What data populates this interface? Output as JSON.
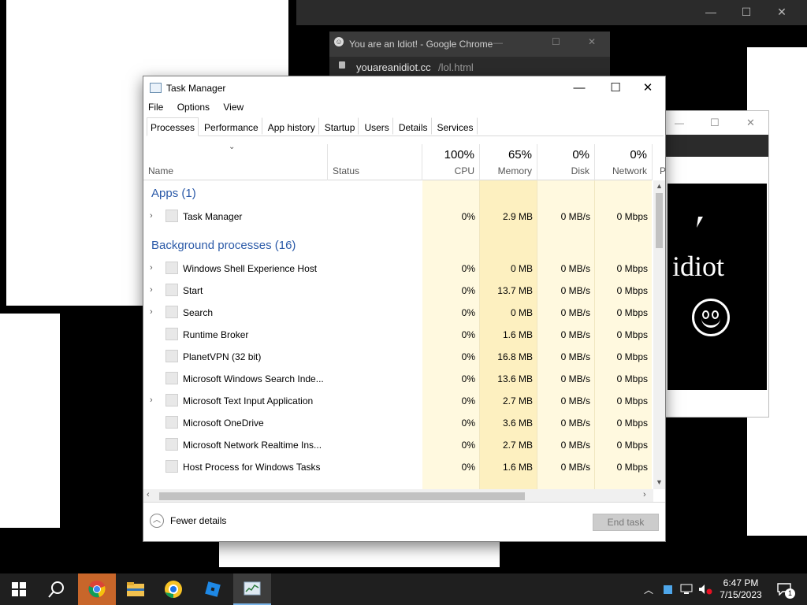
{
  "background_windows": {
    "back_controls": [
      "—",
      "☐",
      "✕"
    ],
    "right_popup_controls": [
      "—",
      "☐",
      "✕"
    ],
    "popup_text": "idiot"
  },
  "chrome_popup": {
    "title": "You are an Idiot! - Google Chrome",
    "url_host": "youareanidiot.cc",
    "url_path": "/lol.html",
    "controls": [
      "—",
      "☐",
      "✕"
    ]
  },
  "task_manager": {
    "title": "Task Manager",
    "controls": [
      "—",
      "☐",
      "✕"
    ],
    "menu": [
      "File",
      "Options",
      "View"
    ],
    "tabs": [
      "Processes",
      "Performance",
      "App history",
      "Startup",
      "Users",
      "Details",
      "Services"
    ],
    "active_tab": "Processes",
    "columns": {
      "name": "Name",
      "status": "Status",
      "cpu": {
        "percent": "100%",
        "label": "CPU"
      },
      "memory": {
        "percent": "65%",
        "label": "Memory"
      },
      "disk": {
        "percent": "0%",
        "label": "Disk"
      },
      "network": {
        "percent": "0%",
        "label": "Network"
      },
      "power_truncated": "P"
    },
    "groups": {
      "apps": "Apps (1)",
      "background": "Background processes (16)"
    },
    "app_rows": [
      {
        "name": "Task Manager",
        "expandable": true,
        "cpu": "0%",
        "memory": "2.9 MB",
        "disk": "0 MB/s",
        "network": "0 Mbps"
      }
    ],
    "bg_rows": [
      {
        "name": "Windows Shell Experience Host",
        "expandable": true,
        "cpu": "0%",
        "memory": "0 MB",
        "disk": "0 MB/s",
        "network": "0 Mbps"
      },
      {
        "name": "Start",
        "expandable": true,
        "cpu": "0%",
        "memory": "13.7 MB",
        "disk": "0 MB/s",
        "network": "0 Mbps"
      },
      {
        "name": "Search",
        "expandable": true,
        "cpu": "0%",
        "memory": "0 MB",
        "disk": "0 MB/s",
        "network": "0 Mbps"
      },
      {
        "name": "Runtime Broker",
        "expandable": false,
        "cpu": "0%",
        "memory": "1.6 MB",
        "disk": "0 MB/s",
        "network": "0 Mbps"
      },
      {
        "name": "PlanetVPN (32 bit)",
        "expandable": false,
        "cpu": "0%",
        "memory": "16.8 MB",
        "disk": "0 MB/s",
        "network": "0 Mbps"
      },
      {
        "name": "Microsoft Windows Search Inde...",
        "expandable": false,
        "cpu": "0%",
        "memory": "13.6 MB",
        "disk": "0 MB/s",
        "network": "0 Mbps"
      },
      {
        "name": "Microsoft Text Input Application",
        "expandable": true,
        "cpu": "0%",
        "memory": "2.7 MB",
        "disk": "0 MB/s",
        "network": "0 Mbps"
      },
      {
        "name": "Microsoft OneDrive",
        "expandable": false,
        "cpu": "0%",
        "memory": "3.6 MB",
        "disk": "0 MB/s",
        "network": "0 Mbps"
      },
      {
        "name": "Microsoft Network Realtime Ins...",
        "expandable": false,
        "cpu": "0%",
        "memory": "2.7 MB",
        "disk": "0 MB/s",
        "network": "0 Mbps"
      },
      {
        "name": "Host Process for Windows Tasks",
        "expandable": false,
        "cpu": "0%",
        "memory": "1.6 MB",
        "disk": "0 MB/s",
        "network": "0 Mbps"
      }
    ],
    "fewer_details": "Fewer details",
    "end_task": "End task"
  },
  "taskbar": {
    "icons": [
      "windows-start-icon",
      "search-icon",
      "chrome-icon",
      "file-explorer-icon",
      "chrome-canary-icon",
      "roblox-icon",
      "task-manager-icon"
    ],
    "time": "6:47 PM",
    "date": "7/15/2023",
    "notification_count": "1"
  },
  "colors": {
    "group_header": "#2b5aa8",
    "cpu_bg": "#fff9df",
    "memory_bg": "#fdf0c0",
    "taskbar": "#1f1f1f"
  }
}
